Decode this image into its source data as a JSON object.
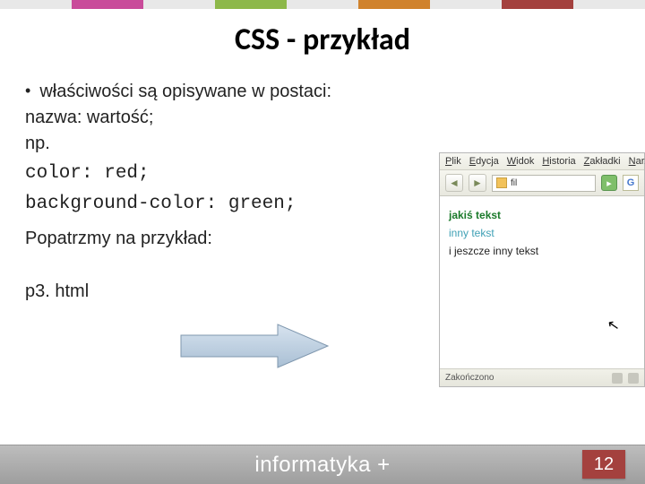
{
  "slide": {
    "title": "CSS - przykład",
    "bullet_text": "właściwości są opisywane w postaci:",
    "property_format": "nazwa: wartość;",
    "example_label": "np.",
    "code_line1": "color: red;",
    "code_line2": "background-color: green;",
    "look_text": "Popatrzmy na przykład:",
    "link_example": "p3. html"
  },
  "browser": {
    "menu": {
      "plik": "Plik",
      "edycja": "Edycja",
      "widok": "Widok",
      "historia": "Historia",
      "zakladki": "Zakładki",
      "narzedzia": "Narzędzia"
    },
    "address_text": "fil",
    "go_label": "G",
    "body": {
      "line1": "jakiś tekst",
      "line2": "inny tekst",
      "line3": "i jeszcze inny tekst"
    },
    "status_text": "Zakończono"
  },
  "footer": {
    "brand": "informatyka +",
    "page_number": "12"
  }
}
